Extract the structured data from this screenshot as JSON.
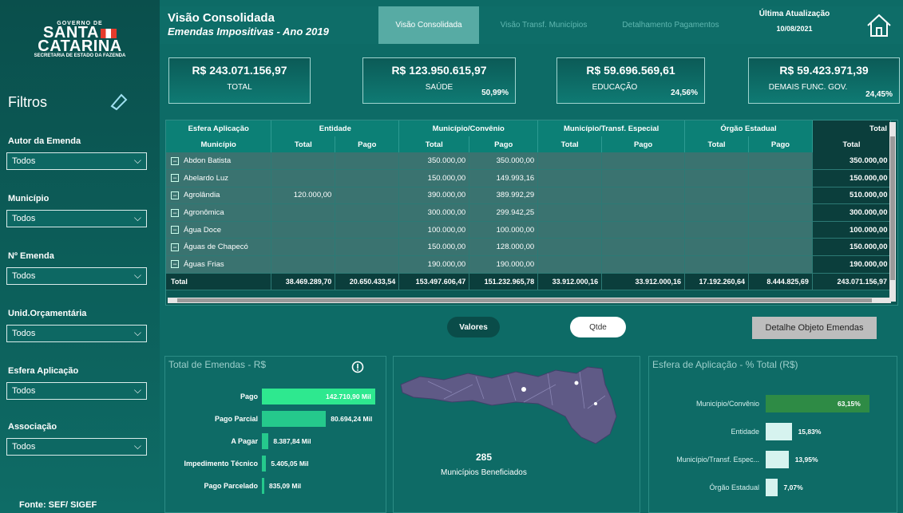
{
  "logo": {
    "gov": "GOVERNO DE",
    "state_line1": "SANTA",
    "state_line2": "CATARINA",
    "secretaria": "SECRETARIA DE ESTADO DA FAZENDA"
  },
  "sidebar": {
    "title": "Filtros",
    "filters": [
      {
        "label": "Autor da Emenda",
        "value": "Todos"
      },
      {
        "label": "Município",
        "value": "Todos"
      },
      {
        "label": "Nº Emenda",
        "value": "Todos"
      },
      {
        "label": "Unid.Orçamentária",
        "value": "Todos"
      },
      {
        "label": "Esfera Aplicação",
        "value": "Todos"
      },
      {
        "label": "Associação",
        "value": "Todos"
      }
    ],
    "fonte": "Fonte: SEF/ SIGEF"
  },
  "header": {
    "title": "Visão Consolidada",
    "subtitle": "Emendas Impositivas - Ano 2019",
    "tabs": [
      "Visão Consolidada",
      "Visão Transf. Municípios",
      "Detalhamento Pagamentos"
    ],
    "updated_label": "Última Atualização",
    "updated_date": "10/08/2021"
  },
  "cards": [
    {
      "value": "R$ 243.071.156,97",
      "label": "TOTAL",
      "pct": ""
    },
    {
      "value": "R$ 123.950.615,97",
      "label": "SAÚDE",
      "pct": "50,99%"
    },
    {
      "value": "R$ 59.696.569,61",
      "label": "EDUCAÇÃO",
      "pct": "24,56%"
    },
    {
      "value": "R$ 59.423.971,39",
      "label": "DEMAIS FUNC. GOV.",
      "pct": "24,45%"
    }
  ],
  "table": {
    "group_headers": [
      "Esfera Aplicação",
      "Entidade",
      "Município/Convênio",
      "Município/Transf. Especial",
      "Órgão Estadual",
      "Total"
    ],
    "sub_headers": [
      "Município",
      "Total",
      "Pago",
      "Total",
      "Pago",
      "Total",
      "Pago",
      "Total",
      "Pago",
      "Total"
    ],
    "rows": [
      [
        "Abdon Batista",
        "",
        "",
        "350.000,00",
        "350.000,00",
        "",
        "",
        "",
        "",
        "350.000,00"
      ],
      [
        "Abelardo Luz",
        "",
        "",
        "150.000,00",
        "149.993,16",
        "",
        "",
        "",
        "",
        "150.000,00"
      ],
      [
        "Agrolândia",
        "120.000,00",
        "",
        "390.000,00",
        "389.992,29",
        "",
        "",
        "",
        "",
        "510.000,00"
      ],
      [
        "Agronômica",
        "",
        "",
        "300.000,00",
        "299.942,25",
        "",
        "",
        "",
        "",
        "300.000,00"
      ],
      [
        "Água Doce",
        "",
        "",
        "100.000,00",
        "100.000,00",
        "",
        "",
        "",
        "",
        "100.000,00"
      ],
      [
        "Águas de Chapecó",
        "",
        "",
        "150.000,00",
        "128.000,00",
        "",
        "",
        "",
        "",
        "150.000,00"
      ],
      [
        "Águas Frias",
        "",
        "",
        "190.000,00",
        "190.000,00",
        "",
        "",
        "",
        "",
        "190.000,00"
      ]
    ],
    "total_row": [
      "Total",
      "38.469.289,70",
      "20.650.433,54",
      "153.497.606,47",
      "151.232.965,78",
      "33.912.000,16",
      "33.912.000,16",
      "17.192.260,64",
      "8.444.825,69",
      "243.071.156,97"
    ]
  },
  "buttons": {
    "valores": "Valores",
    "qtde": "Qtde",
    "detalhe": "Detalhe Objeto Emendas"
  },
  "panel_total": {
    "title": "Total de Emendas - R$",
    "bars": [
      {
        "label": "Pago",
        "value": 142710.9,
        "text": "142.710,90 Mil"
      },
      {
        "label": "Pago Parcial",
        "value": 80694.24,
        "text": "80.694,24 Mil"
      },
      {
        "label": "A Pagar",
        "value": 8387.84,
        "text": "8.387,84 Mil"
      },
      {
        "label": "Impedimento Técnico",
        "value": 5405.05,
        "text": "5.405,05 Mil"
      },
      {
        "label": "Pago Parcelado",
        "value": 835.09,
        "text": "835,09 Mil"
      }
    ]
  },
  "map": {
    "count": "285",
    "label": "Municípios Beneficiados"
  },
  "panel_esfera": {
    "title": "Esfera de Aplicação - % Total (R$)",
    "bars": [
      {
        "label": "Município/Convênio",
        "value": 63.15,
        "text": "63,15%"
      },
      {
        "label": "Entidade",
        "value": 15.83,
        "text": "15,83%"
      },
      {
        "label": "Município/Transf. Espec...",
        "value": 13.95,
        "text": "13,95%"
      },
      {
        "label": "Órgão Estadual",
        "value": 7.07,
        "text": "7,07%"
      }
    ]
  },
  "colors": {
    "bar_pago": "#2ee88f",
    "bar_other": "#25c98c",
    "esfera_top": "#2e8b45",
    "esfera_rest": "#d6f3ef"
  }
}
